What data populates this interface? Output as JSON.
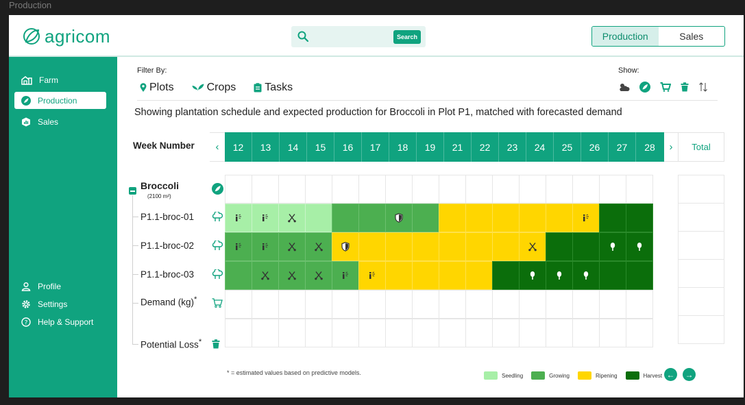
{
  "window_title": "Production",
  "app": {
    "logo_text": "agricom",
    "search": {
      "placeholder": "",
      "button_label": "Search"
    },
    "view_toggle": {
      "production": "Production",
      "sales": "Sales",
      "active": "Production"
    }
  },
  "sidebar": {
    "items": [
      {
        "label": "Farm",
        "icon": "farm-icon"
      },
      {
        "label": "Production",
        "icon": "leaf-icon",
        "active": true
      },
      {
        "label": "Sales",
        "icon": "sales-icon"
      }
    ],
    "bottom_items": [
      {
        "label": "Profile",
        "icon": "user-icon"
      },
      {
        "label": "Settings",
        "icon": "gear-icon"
      },
      {
        "label": "Help & Support",
        "icon": "help-icon"
      }
    ]
  },
  "filters": {
    "label": "Filter By:",
    "options": [
      {
        "label": "Plots",
        "icon": "pin-icon"
      },
      {
        "label": "Crops",
        "icon": "sprout-icon"
      },
      {
        "label": "Tasks",
        "icon": "clipboard-icon"
      }
    ]
  },
  "show": {
    "label": "Show:",
    "icons": [
      "weather-icon",
      "leaf-icon",
      "cart-icon",
      "trash-icon",
      "sort-icon"
    ]
  },
  "description": "Showing plantation schedule and expected production for Broccoli in Plot P1, matched with forecasted demand",
  "schedule": {
    "week_label": "Week Number",
    "weeks": [
      "12",
      "13",
      "14",
      "15",
      "16",
      "17",
      "18",
      "19",
      "21",
      "22",
      "23",
      "24",
      "25",
      "26",
      "27",
      "28"
    ],
    "total_label": "Total",
    "crop": {
      "name": "Broccoli",
      "area": "(2100 m²)"
    },
    "rows": [
      {
        "label": "P1.1-broc-01",
        "cells": [
          "s",
          "s",
          "s",
          "s",
          "g",
          "g",
          "g",
          "g",
          "r",
          "r",
          "r",
          "r",
          "r",
          "r",
          "h",
          "h"
        ],
        "icons": [
          "sprinkler",
          "sprinkler",
          "harvest",
          "",
          "",
          "",
          "shield",
          "",
          "",
          "",
          "",
          "",
          "",
          "sprinkler",
          "",
          ""
        ]
      },
      {
        "label": "P1.1-broc-02",
        "cells": [
          "g",
          "g",
          "g",
          "g",
          "r",
          "r",
          "r",
          "r",
          "r",
          "r",
          "r",
          "r",
          "h",
          "h",
          "h",
          "h"
        ],
        "icons": [
          "sprinkler",
          "sprinkler",
          "harvest",
          "harvest",
          "shield",
          "",
          "",
          "",
          "",
          "",
          "",
          "harvest",
          "",
          "",
          "sprout",
          "sprout"
        ]
      },
      {
        "label": "P1.1-broc-03",
        "cells": [
          "g",
          "g",
          "g",
          "g",
          "g",
          "r",
          "r",
          "r",
          "r",
          "r",
          "h",
          "h",
          "h",
          "h",
          "h",
          "h"
        ],
        "icons": [
          "",
          "harvest",
          "harvest",
          "harvest",
          "sprinkler",
          "sprinkler",
          "",
          "",
          "",
          "",
          "",
          "sprout",
          "sprout",
          "sprout",
          "",
          ""
        ]
      }
    ],
    "demand_label": "Demand (kg)",
    "loss_label": "Potential Loss",
    "asterisk": "*"
  },
  "footnote": "* = estimated values based on predictive models.",
  "legend": [
    {
      "label": "Seedling",
      "color": "#a7efa7"
    },
    {
      "label": "Growing",
      "color": "#4caf50"
    },
    {
      "label": "Ripening",
      "color": "#ffd600"
    },
    {
      "label": "Harvest",
      "color": "#0b6e0b"
    }
  ],
  "colors": {
    "accent": "#10a37f"
  }
}
